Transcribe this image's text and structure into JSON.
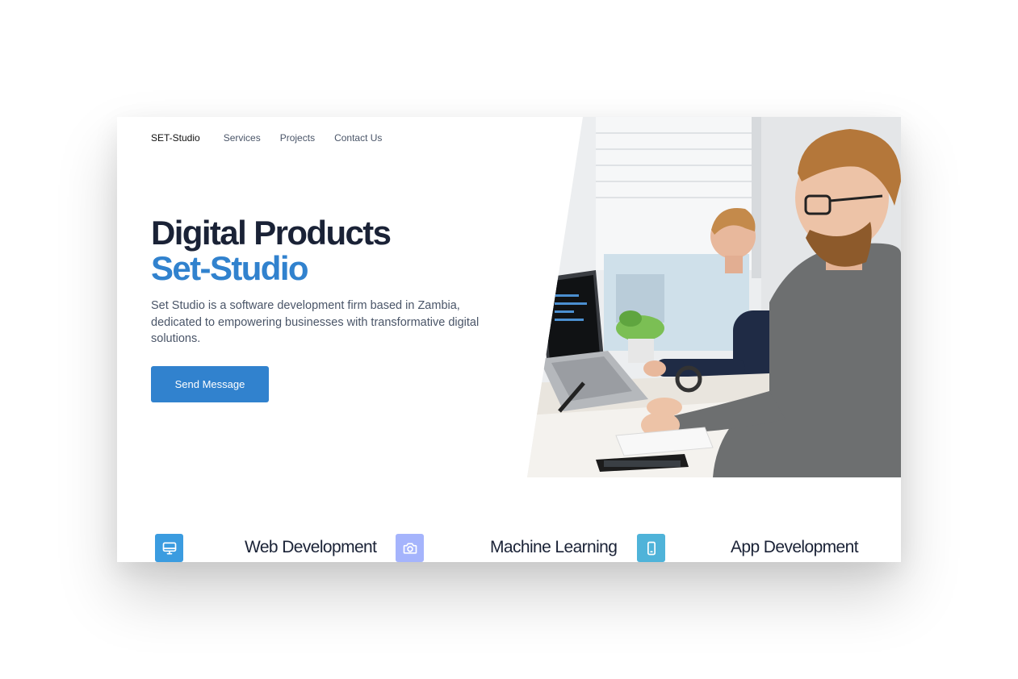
{
  "nav": {
    "brand": "SET-Studio",
    "links": [
      "Services",
      "Projects",
      "Contact Us"
    ]
  },
  "hero": {
    "title_line1": "Digital Products",
    "title_line2": "Set-Studio",
    "description": "Set Studio is a software development firm based in Zambia, dedicated to empowering businesses with transformative digital solutions.",
    "cta_label": "Send Message",
    "image_icon": "office-photo-icon"
  },
  "services": [
    {
      "title": "Web Development",
      "icon": "monitor-icon",
      "color": "#3b9ce0"
    },
    {
      "title": "Machine Learning",
      "icon": "camera-icon",
      "color": "#a5b4fc"
    },
    {
      "title": "App Development",
      "icon": "smartphone-icon",
      "color": "#4fb3d9"
    }
  ],
  "colors": {
    "accent": "#3182ce",
    "heading": "#1a2236",
    "body_text": "#4a5568"
  }
}
